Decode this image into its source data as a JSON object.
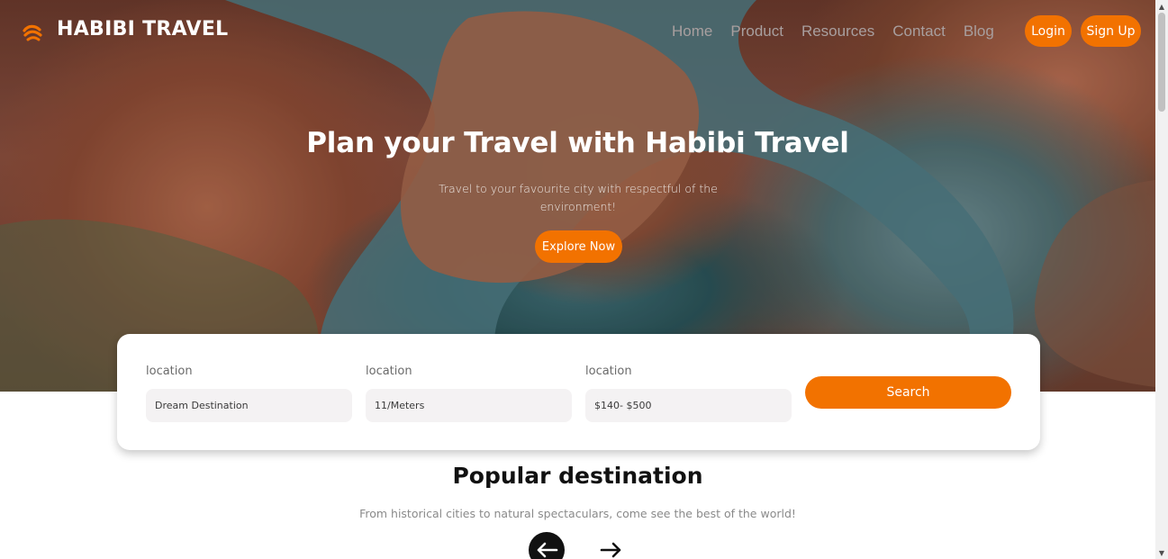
{
  "brand": {
    "name": "HABIBI TRAVEL",
    "logo_icon": "logo-swirl-icon",
    "accent_color": "#f27200"
  },
  "nav": {
    "links": [
      "Home",
      "Product",
      "Resources",
      "Contact",
      "Blog"
    ],
    "login_label": "Login",
    "signup_label": "Sign Up"
  },
  "hero": {
    "title": "Plan your Travel with Habibi Travel",
    "subtitle": "Travel to your favourite city with respectful of the environment!",
    "cta_label": "Explore Now"
  },
  "search": {
    "fields": [
      {
        "label": "location",
        "value": "Dream Destination"
      },
      {
        "label": "location",
        "value": "11/Meters"
      },
      {
        "label": "location",
        "value": "$140- $500"
      }
    ],
    "button_label": "Search"
  },
  "popular": {
    "title": "Popular destination",
    "subtitle": "From historical cities to natural spectaculars, come see the best of the world!",
    "prev_icon": "arrow-left-icon",
    "next_icon": "arrow-right-icon"
  }
}
